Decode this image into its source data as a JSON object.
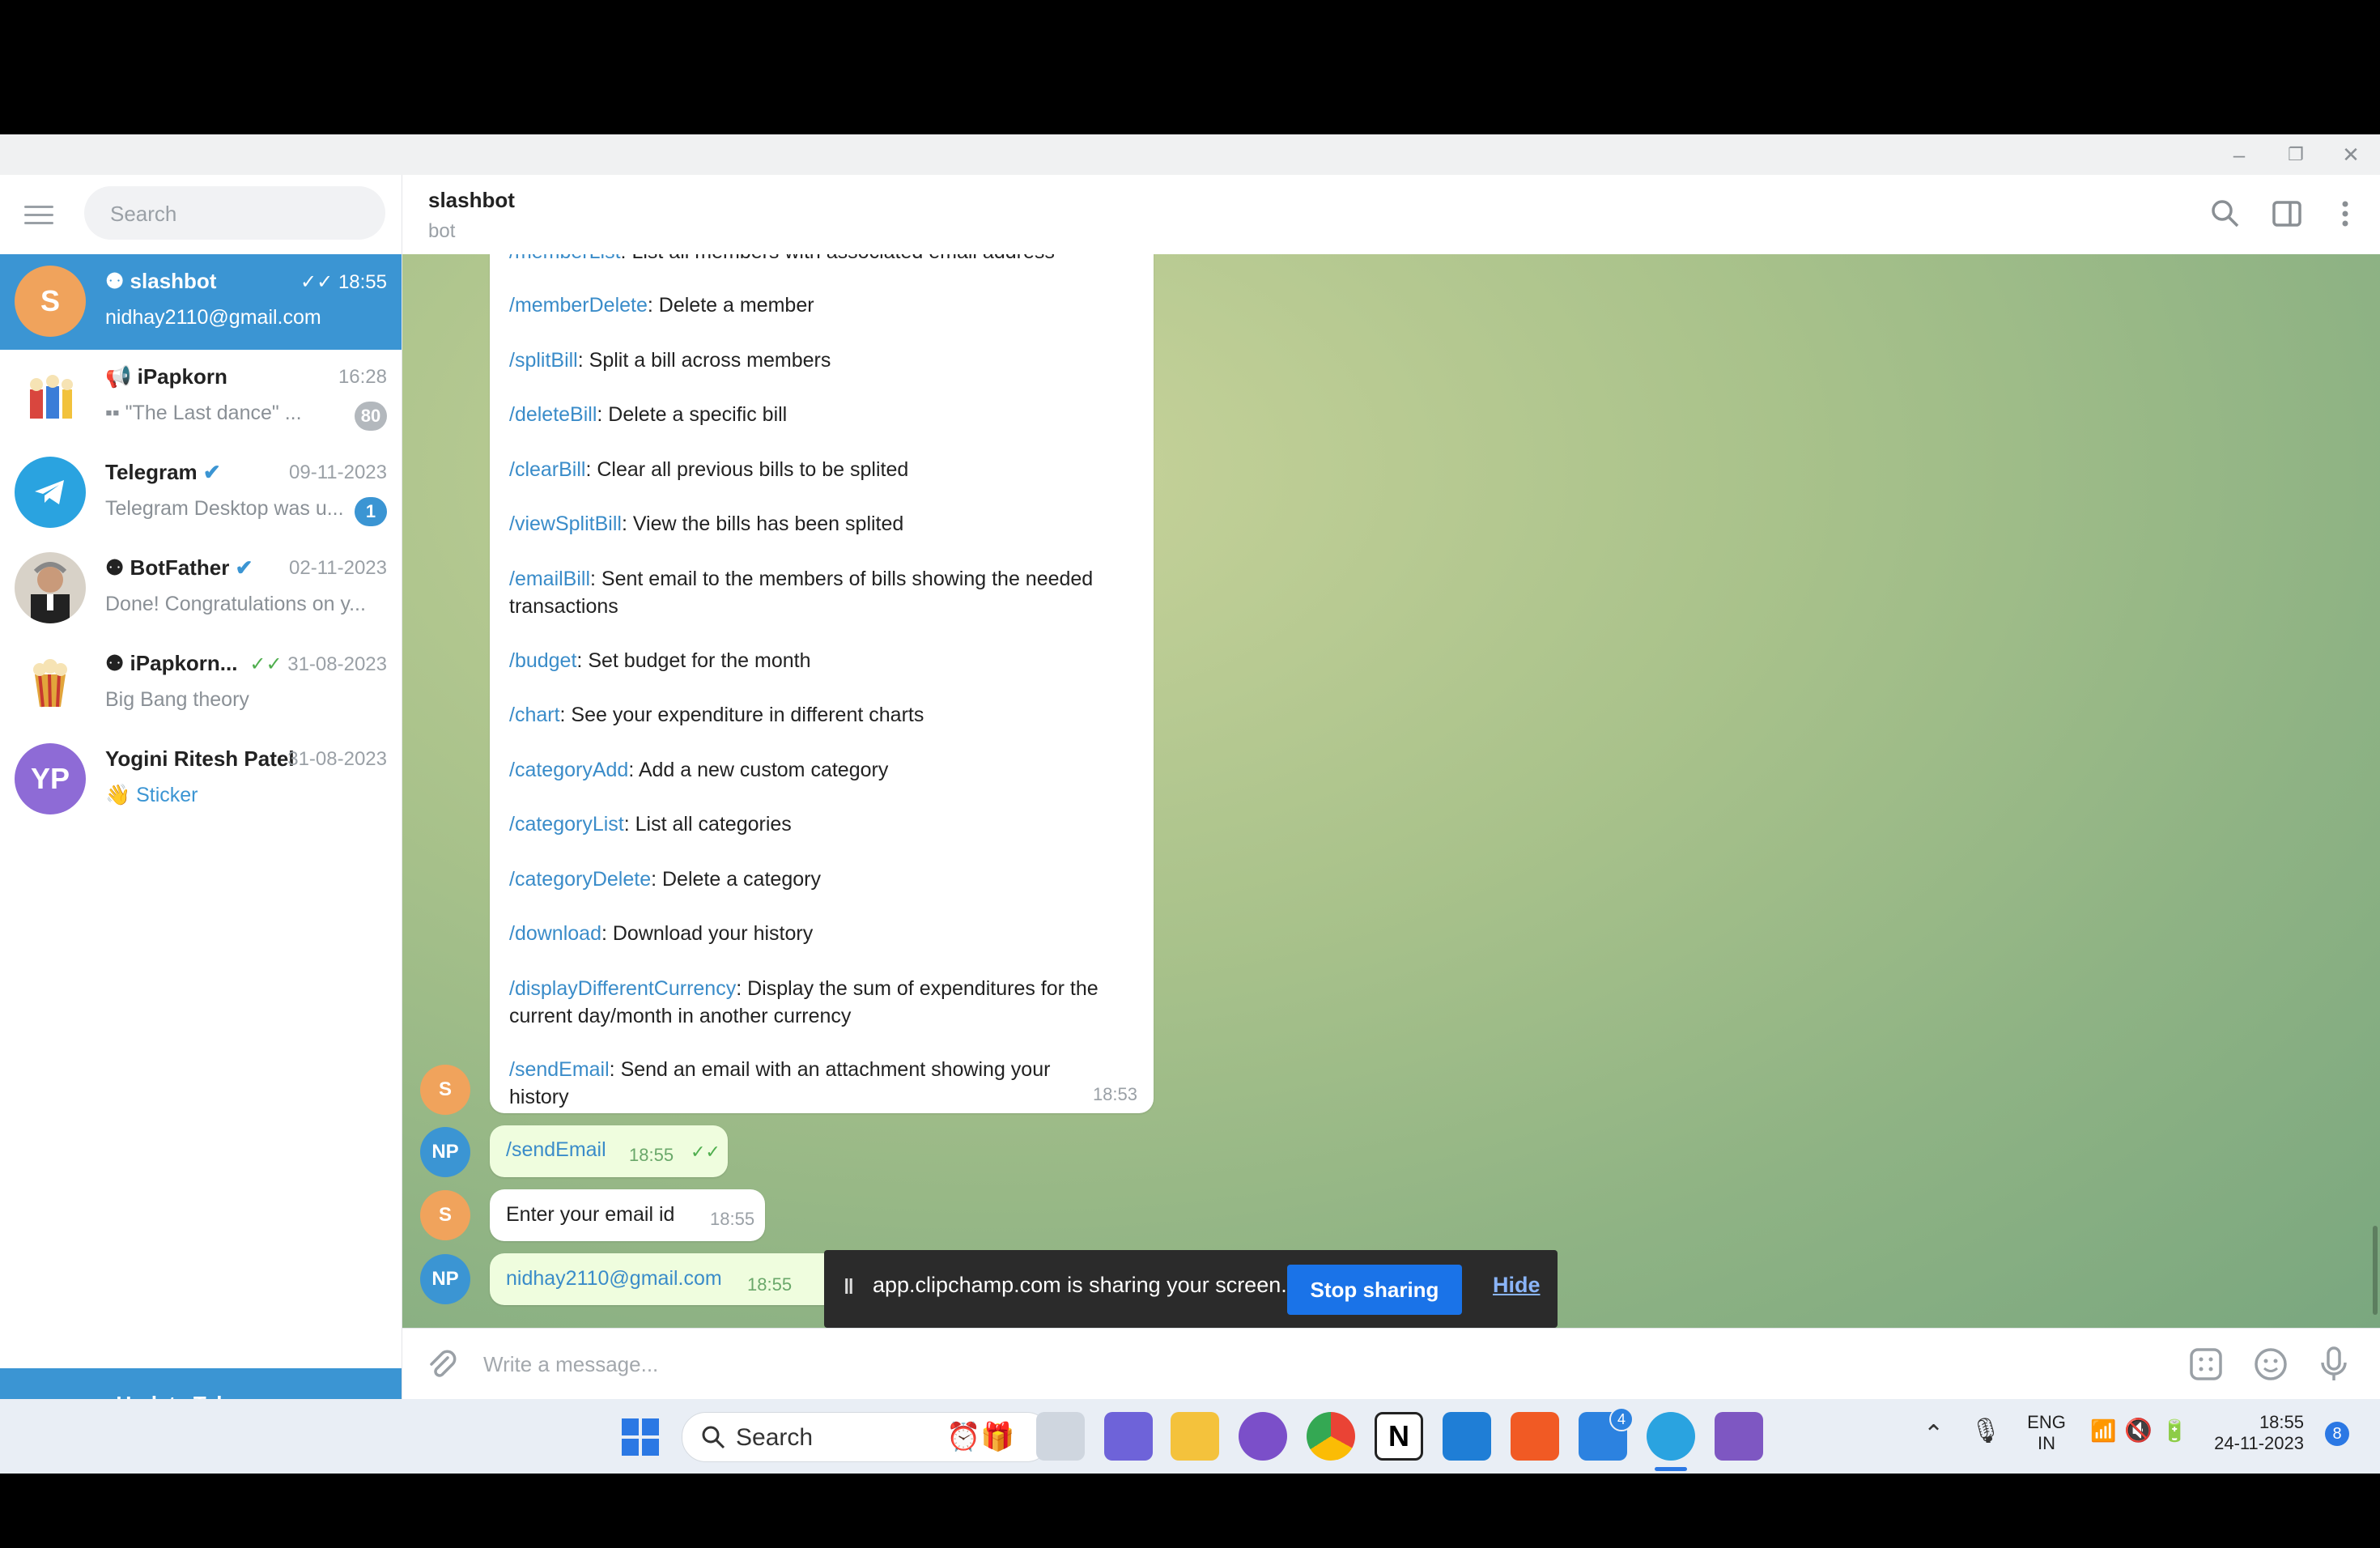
{
  "window": {
    "minimize": "–",
    "restore": "❐",
    "close": "✕"
  },
  "sidebar": {
    "search_placeholder": "Search",
    "chats": [
      {
        "name": "slashbot",
        "time": "18:55",
        "preview": "nidhay2110@gmail.com",
        "avatar": "S",
        "avatar_color": "#f0a35c",
        "active": true
      },
      {
        "name": "iPapkorn",
        "time": "16:28",
        "preview": "\"The Last dance\" ...",
        "badge": "80",
        "avatar": "",
        "avatar_color": "#ffffff"
      },
      {
        "name": "Telegram",
        "time": "09-11-2023",
        "preview": "Telegram Desktop was u...",
        "badge": "1",
        "avatar": "",
        "avatar_color": "#2aa3e0"
      },
      {
        "name": "BotFather",
        "time": "02-11-2023",
        "preview": "Done! Congratulations on y...",
        "avatar": "",
        "avatar_color": "#d8d2c8"
      },
      {
        "name": "iPapkorn...",
        "time": "31-08-2023",
        "preview": "Big Bang theory",
        "avatar": "",
        "avatar_color": "#ffffff"
      },
      {
        "name": "Yogini Ritesh Patel",
        "time": "31-08-2023",
        "preview": "Sticker",
        "preview_emoji": "👋",
        "avatar": "YP",
        "avatar_color": "#8e6bd6"
      }
    ],
    "update_button": "Update Telegram"
  },
  "header": {
    "title": "slashbot",
    "subtitle": "bot"
  },
  "messages": {
    "command_list": [
      {
        "cmd": "/memberList",
        "desc": ": List all members with associated email address"
      },
      {
        "cmd": "/memberDelete",
        "desc": ": Delete a member"
      },
      {
        "cmd": "/splitBill",
        "desc": ": Split a bill across members"
      },
      {
        "cmd": "/deleteBill",
        "desc": ": Delete a specific bill"
      },
      {
        "cmd": "/clearBill",
        "desc": ": Clear all previous bills to be splited"
      },
      {
        "cmd": "/viewSplitBill",
        "desc": ": View the bills has been splited"
      },
      {
        "cmd": "/emailBill",
        "desc": ": Sent email to the members of bills showing the needed",
        "desc2": "transactions"
      },
      {
        "cmd": "/budget",
        "desc": ": Set budget for the month"
      },
      {
        "cmd": "/chart",
        "desc": ": See your expenditure in different charts"
      },
      {
        "cmd": "/categoryAdd",
        "desc": ": Add a new custom category"
      },
      {
        "cmd": "/categoryList",
        "desc": ": List all categories"
      },
      {
        "cmd": "/categoryDelete",
        "desc": ": Delete a category"
      },
      {
        "cmd": "/download",
        "desc": ": Download your history"
      },
      {
        "cmd": "/displayDifferentCurrency",
        "desc": ": Display the sum of expenditures for the",
        "desc2": "current day/month in another currency"
      },
      {
        "cmd": "/sendEmail",
        "desc": ": Send an email with an attachment showing your",
        "desc2": "history"
      }
    ],
    "command_list_time": "18:53",
    "bot_avatar": "S",
    "user_avatar": "NP",
    "user_send_email": "/sendEmail",
    "user_send_email_time": "18:55",
    "bot_prompt": "Enter your email id",
    "bot_prompt_time": "18:55",
    "user_email": "nidhay2110@gmail.com",
    "user_email_time": "18:55"
  },
  "share_banner": {
    "text": "app.clipchamp.com is sharing your screen.",
    "stop": "Stop sharing",
    "hide": "Hide"
  },
  "composer": {
    "placeholder": "Write a message..."
  },
  "taskbar": {
    "search": "Search",
    "notification_count": "4",
    "lang": "ENG",
    "region": "IN",
    "time": "18:55",
    "date": "24-11-2023",
    "notif_badge": "8"
  },
  "colors": {
    "accent": "#3b95d3",
    "link": "#3a8cc9",
    "outgoing_bubble": "#effdde"
  }
}
